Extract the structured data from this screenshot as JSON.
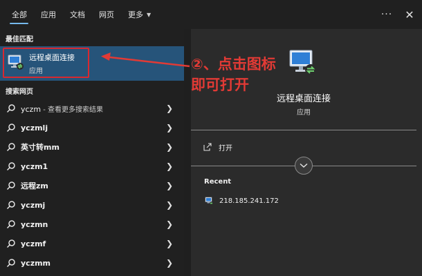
{
  "tabs": [
    {
      "label": "全部",
      "active": true
    },
    {
      "label": "应用",
      "active": false
    },
    {
      "label": "文档",
      "active": false
    },
    {
      "label": "网页",
      "active": false
    },
    {
      "label": "更多",
      "active": false
    }
  ],
  "toolbar": {
    "more_label": "···",
    "close_label": "✕"
  },
  "left": {
    "best_match_title": "最佳匹配",
    "best_match": {
      "name": "远程桌面连接",
      "type": "应用"
    },
    "web_title": "搜索网页",
    "web_items": [
      {
        "text": "yczm",
        "sub": " - 查看更多搜索结果"
      },
      {
        "text": "yczmlj",
        "sub": ""
      },
      {
        "text": "英寸转mm",
        "sub": ""
      },
      {
        "text": "yczm1",
        "sub": ""
      },
      {
        "text": "远程zm",
        "sub": ""
      },
      {
        "text": "yczmj",
        "sub": ""
      },
      {
        "text": "yczmn",
        "sub": ""
      },
      {
        "text": "yczmf",
        "sub": ""
      },
      {
        "text": "yczmm",
        "sub": ""
      }
    ]
  },
  "right": {
    "app_title": "远程桌面连接",
    "app_sub": "应用",
    "open_label": "打开",
    "recent_title": "Recent",
    "recent_items": [
      {
        "label": "218.185.241.172"
      }
    ]
  },
  "annotation": {
    "line1": "②、点击图标",
    "line2": "即可打开"
  },
  "colors": {
    "accent": "#76b9ed",
    "highlight_row": "#26547a",
    "annotation_red": "#e23a35"
  }
}
